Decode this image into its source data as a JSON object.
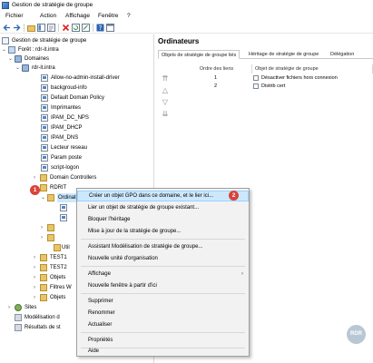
{
  "window": {
    "title": "Gestion de stratégie de groupe"
  },
  "menubar": [
    "Fichier",
    "Action",
    "Affichage",
    "Fenêtre",
    "?"
  ],
  "toolbar": [
    "back-arrow-icon",
    "forward-arrow-icon",
    "folder-up-icon",
    "tree-toggle-icon",
    "properties-icon",
    "delete-icon",
    "refresh-icon",
    "export-icon",
    "help-icon",
    "console-icon"
  ],
  "tree": {
    "root": "Gestion de stratégie de groupe",
    "forest": "Forêt : rdr-it.intra",
    "domains": "Domaines",
    "domain": "rdr-it.intra",
    "gpos": [
      "Allow-no-admin-install-driver",
      "backgroud-info",
      "Default Domain Policy",
      "Imprimantes",
      "IPAM_DC_NPS",
      "IPAM_DHCP",
      "IPAM_DNS",
      "Lecteur reseau",
      "Param poste",
      "script-logon"
    ],
    "domain_controllers": "Domain Controllers",
    "rdrit": "RDRIT",
    "ordinateurs": "Ordinateurs",
    "utilisateurs_truncated": "Util",
    "test1": "TEST1",
    "test2": "TEST2",
    "objets1": "Objets",
    "filtres": "Filtres W",
    "objets2": "Objets",
    "sites": "Sites",
    "modelisation": "Modélisation d",
    "resultats": "Résultats de st"
  },
  "right_pane": {
    "title": "Ordinateurs",
    "tabs": [
      "Objets de stratégie de groupe liés",
      "Héritage de stratégie de groupe",
      "Délégation"
    ],
    "columns": [
      "Ordre des liens",
      "Objet de stratégie de groupe"
    ],
    "rows": [
      {
        "order": "1",
        "gpo": "Désactiver fichiers hors connexion"
      },
      {
        "order": "2",
        "gpo": "Distrib cert"
      }
    ]
  },
  "context_menu": {
    "items": [
      "Créer un objet GPO dans ce domaine, et le lier ici...",
      "Lier un objet de stratégie de groupe existant...",
      "Bloquer l'héritage",
      "Mise à jour de la stratégie de groupe...",
      "Assistant Modélisation de stratégie de groupe...",
      "Nouvelle unité d'organisation",
      "Affichage",
      "Nouvelle fenêtre à partir d'ici",
      "Supprimer",
      "Renommer",
      "Actualiser",
      "Propriétés",
      "Aide"
    ]
  },
  "badges": [
    "1",
    "2"
  ],
  "logo": "RDR",
  "colors": {
    "badge": "#d9443a",
    "selection": "#cce8ff",
    "menu_bg": "#f2f2f2"
  }
}
